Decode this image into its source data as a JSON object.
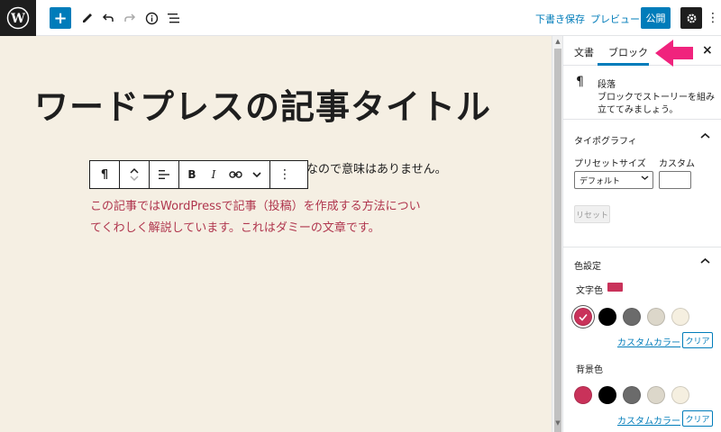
{
  "topbar": {
    "save_draft": "下書き保存",
    "preview": "プレビュー",
    "publish": "公開",
    "add_block_symbol": "+",
    "more_symbol": "⋮"
  },
  "editor": {
    "title": "ワードプレスの記事タイトル",
    "para_behind": "なので意味はありません。",
    "para_red_line1": "この記事ではWordPressで記事（投稿）を作成する方法につい",
    "para_red_line2": "てくわしく解説しています。これはダミーの文章です。",
    "text_color": "#b0364e",
    "background_color": "#f5efe3"
  },
  "block_toolbar": {
    "paragraph_symbol": "¶",
    "bold": "B",
    "italic": "I"
  },
  "sidebar": {
    "tab_document": "文書",
    "tab_block": "ブロック",
    "close": "×",
    "block_icon": "¶",
    "block_name": "段落",
    "block_description": "ブロックでストーリーを組み立ててみましょう。",
    "typography": {
      "title": "タイポグラフィ",
      "preset_label": "プリセットサイズ",
      "custom_label": "カスタム",
      "preset_value": "デフォルト",
      "reset": "リセット"
    },
    "color_settings": {
      "title": "色設定",
      "text_color_label": "文字色",
      "background_color_label": "背景色",
      "custom_color": "カスタムカラー",
      "clear": "クリア",
      "selected_text_color": "#c9325a",
      "palette": [
        "#c9325a",
        "#000000",
        "#6b6b6b",
        "#dcd7ca",
        "#f5efe0"
      ]
    }
  },
  "annotation": {
    "arrow_color": "#f0237d"
  }
}
